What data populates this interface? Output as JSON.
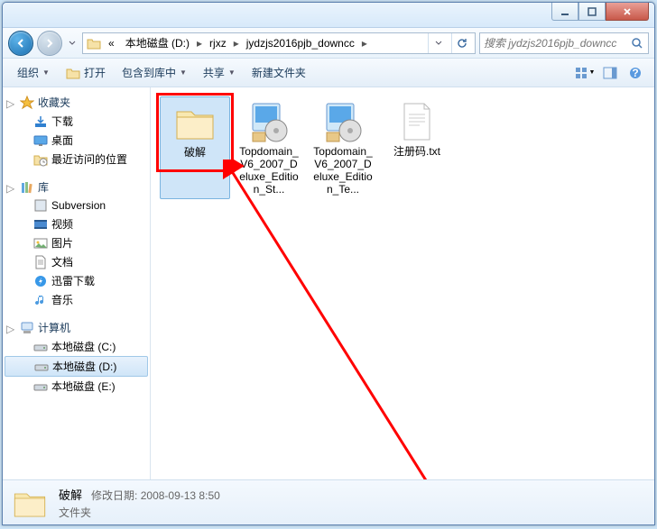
{
  "breadcrumb": {
    "prefix": "«",
    "items": [
      "本地磁盘 (D:)",
      "rjxz",
      "jydzjs2016pjb_downcc"
    ]
  },
  "search": {
    "placeholder": "搜索 jydzjs2016pjb_downcc"
  },
  "toolbar": {
    "organize": "组织",
    "open": "打开",
    "include": "包含到库中",
    "share": "共享",
    "newfolder": "新建文件夹"
  },
  "sidebar": {
    "favorites": {
      "label": "收藏夹",
      "items": [
        "下载",
        "桌面",
        "最近访问的位置"
      ]
    },
    "libraries": {
      "label": "库",
      "items": [
        "Subversion",
        "视频",
        "图片",
        "文档",
        "迅雷下载",
        "音乐"
      ]
    },
    "computer": {
      "label": "计算机",
      "items": [
        "本地磁盘 (C:)",
        "本地磁盘 (D:)",
        "本地磁盘 (E:)"
      ]
    }
  },
  "files": [
    {
      "name": "破解",
      "type": "folder",
      "selected": true
    },
    {
      "name": "Topdomain_V6_2007_Deluxe_Edition_St...",
      "type": "exe"
    },
    {
      "name": "Topdomain_V6_2007_Deluxe_Edition_Te...",
      "type": "exe"
    },
    {
      "name": "注册码.txt",
      "type": "txt"
    }
  ],
  "status": {
    "name": "破解",
    "date_label": "修改日期:",
    "date": "2008-09-13 8:50",
    "type": "文件夹"
  },
  "selected_drive_index": 1
}
